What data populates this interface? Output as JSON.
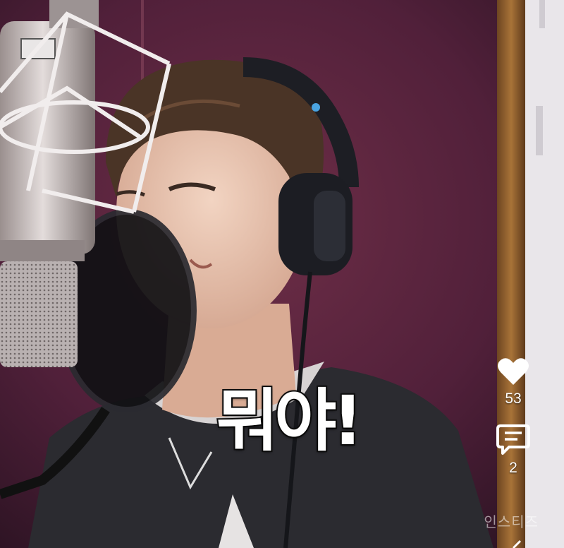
{
  "video": {
    "caption": "뭐야!"
  },
  "actions": {
    "like": {
      "icon": "heart-icon",
      "count": "53"
    },
    "comment": {
      "icon": "comment-icon",
      "count": "2"
    },
    "share": {
      "icon": "share-icon"
    }
  },
  "watermark": "인스티즈",
  "colors": {
    "backdrop": "#5a2338",
    "shirt": "#2b2b30",
    "hair": "#4a3426",
    "skin": "#e8c2ad",
    "door_frame": "#8a5a2b",
    "icon": "#ffffff"
  }
}
